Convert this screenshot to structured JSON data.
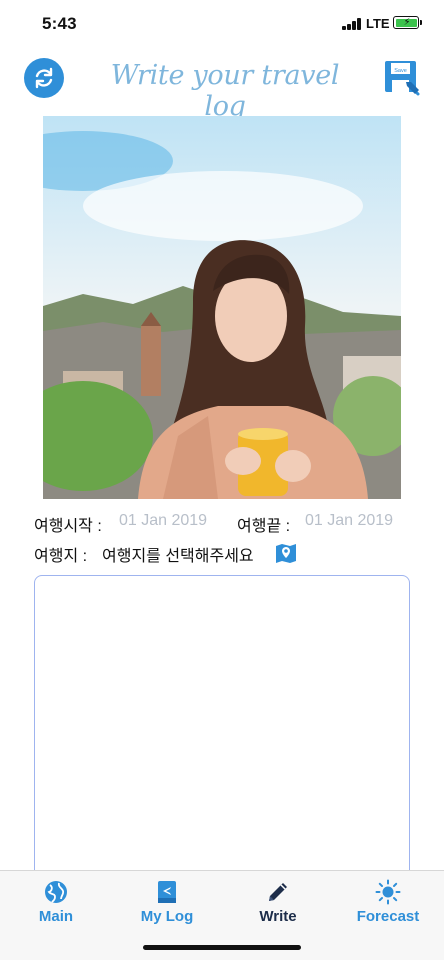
{
  "status_bar": {
    "time": "5:43",
    "network": "LTE"
  },
  "header": {
    "title": "Write your travel log",
    "refresh_icon": "refresh-icon",
    "save_icon": "save-disk-icon",
    "save_icon_label": "Save"
  },
  "photo": {
    "description_icon": "travel-photo"
  },
  "form": {
    "start_label": "여행시작 :",
    "start_value": "01 Jan 2019",
    "end_label": "여행끝 :",
    "end_value": "01 Jan 2019",
    "destination_label": "여행지 :",
    "destination_value": "여행지를 선택해주세요",
    "map_icon": "map-pin-icon",
    "log_text": ""
  },
  "tab_bar": {
    "tabs": [
      {
        "label": "Main",
        "icon": "globe-icon"
      },
      {
        "label": "My Log",
        "icon": "book-icon"
      },
      {
        "label": "Write",
        "icon": "pencil-icon",
        "active": true
      },
      {
        "label": "Forecast",
        "icon": "sun-icon"
      }
    ]
  },
  "colors": {
    "accent": "#2f8fd8",
    "title": "#7fb6dc",
    "active_tab": "#1d2d4a",
    "placeholder": "#b8bfc9"
  }
}
